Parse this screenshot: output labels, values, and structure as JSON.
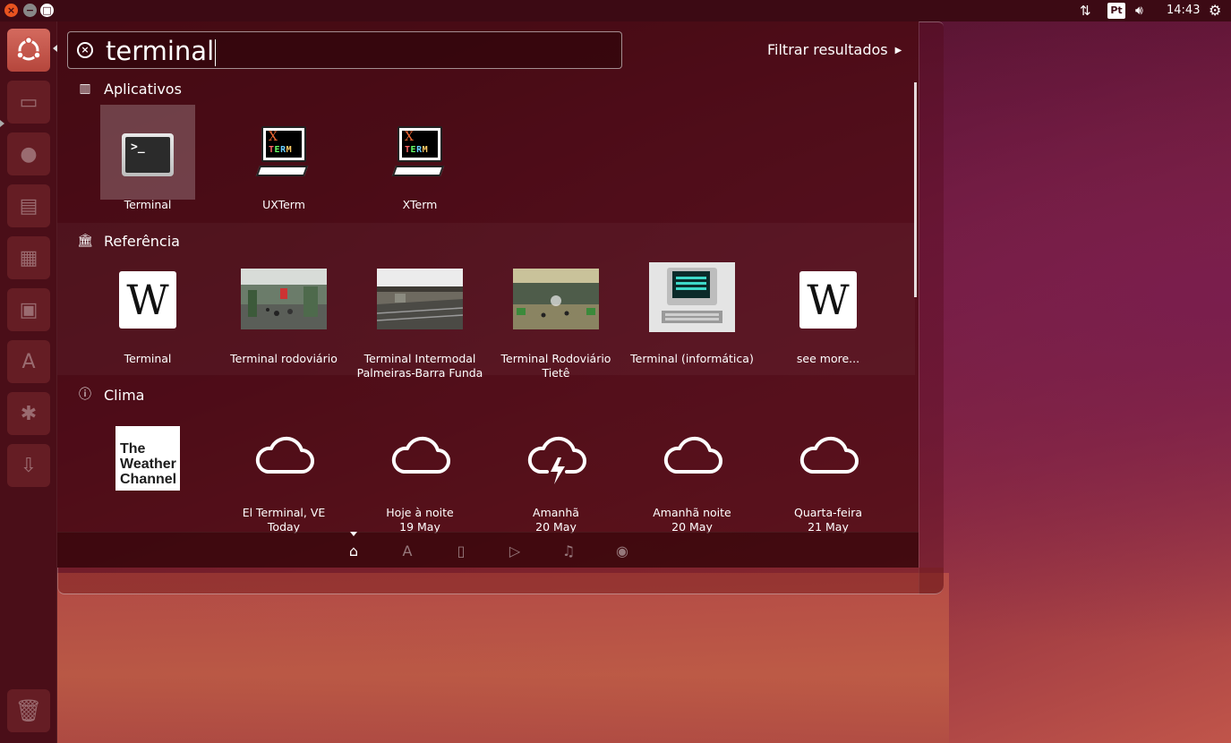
{
  "top_panel": {
    "keyboard_layout": "Pt",
    "clock": "14:43"
  },
  "search": {
    "query": "terminal",
    "filter_label": "Filtrar resultados"
  },
  "categories": [
    {
      "title": "Aplicativos",
      "icon": "apps-icon",
      "items": [
        {
          "label": "Terminal",
          "icon": "terminal-app-icon",
          "selected": true
        },
        {
          "label": "UXTerm",
          "icon": "xterm-app-icon"
        },
        {
          "label": "XTerm",
          "icon": "xterm-app-icon"
        }
      ]
    },
    {
      "title": "Referência",
      "icon": "reference-icon",
      "items": [
        {
          "label": "Terminal",
          "icon": "wikipedia-icon"
        },
        {
          "label": "Terminal rodoviário",
          "icon": "bus-terminal-photo"
        },
        {
          "label": "Terminal Intermodal Palmeiras-Barra Funda",
          "icon": "train-station-photo"
        },
        {
          "label": "Terminal Rodoviário Tietê",
          "icon": "bus-station-photo"
        },
        {
          "label": "Terminal (informática)",
          "icon": "computer-terminal-photo"
        },
        {
          "label": "see more...",
          "icon": "wikipedia-icon"
        }
      ]
    },
    {
      "title": "Clima",
      "icon": "info-icon",
      "logo_text": "The Weather Channel",
      "items": [
        {
          "line1": "El Terminal, VE",
          "line2": "Today",
          "icon": "cloud-icon"
        },
        {
          "line1": "Hoje à noite",
          "line2": "19 May",
          "icon": "cloud-icon"
        },
        {
          "line1": "Amanhã",
          "line2": "20 May",
          "icon": "thunderstorm-icon"
        },
        {
          "line1": "Amanhã noite",
          "line2": "20 May",
          "icon": "cloud-icon"
        },
        {
          "line1": "Quarta-feira",
          "line2": "21 May",
          "icon": "cloud-icon"
        }
      ]
    }
  ],
  "lens_bar": [
    {
      "name": "home-lens",
      "active": true
    },
    {
      "name": "applications-lens"
    },
    {
      "name": "files-lens"
    },
    {
      "name": "video-lens"
    },
    {
      "name": "music-lens"
    },
    {
      "name": "photos-lens"
    }
  ],
  "colors": {
    "accent": "#e95420",
    "panel": "#3c0a14"
  }
}
